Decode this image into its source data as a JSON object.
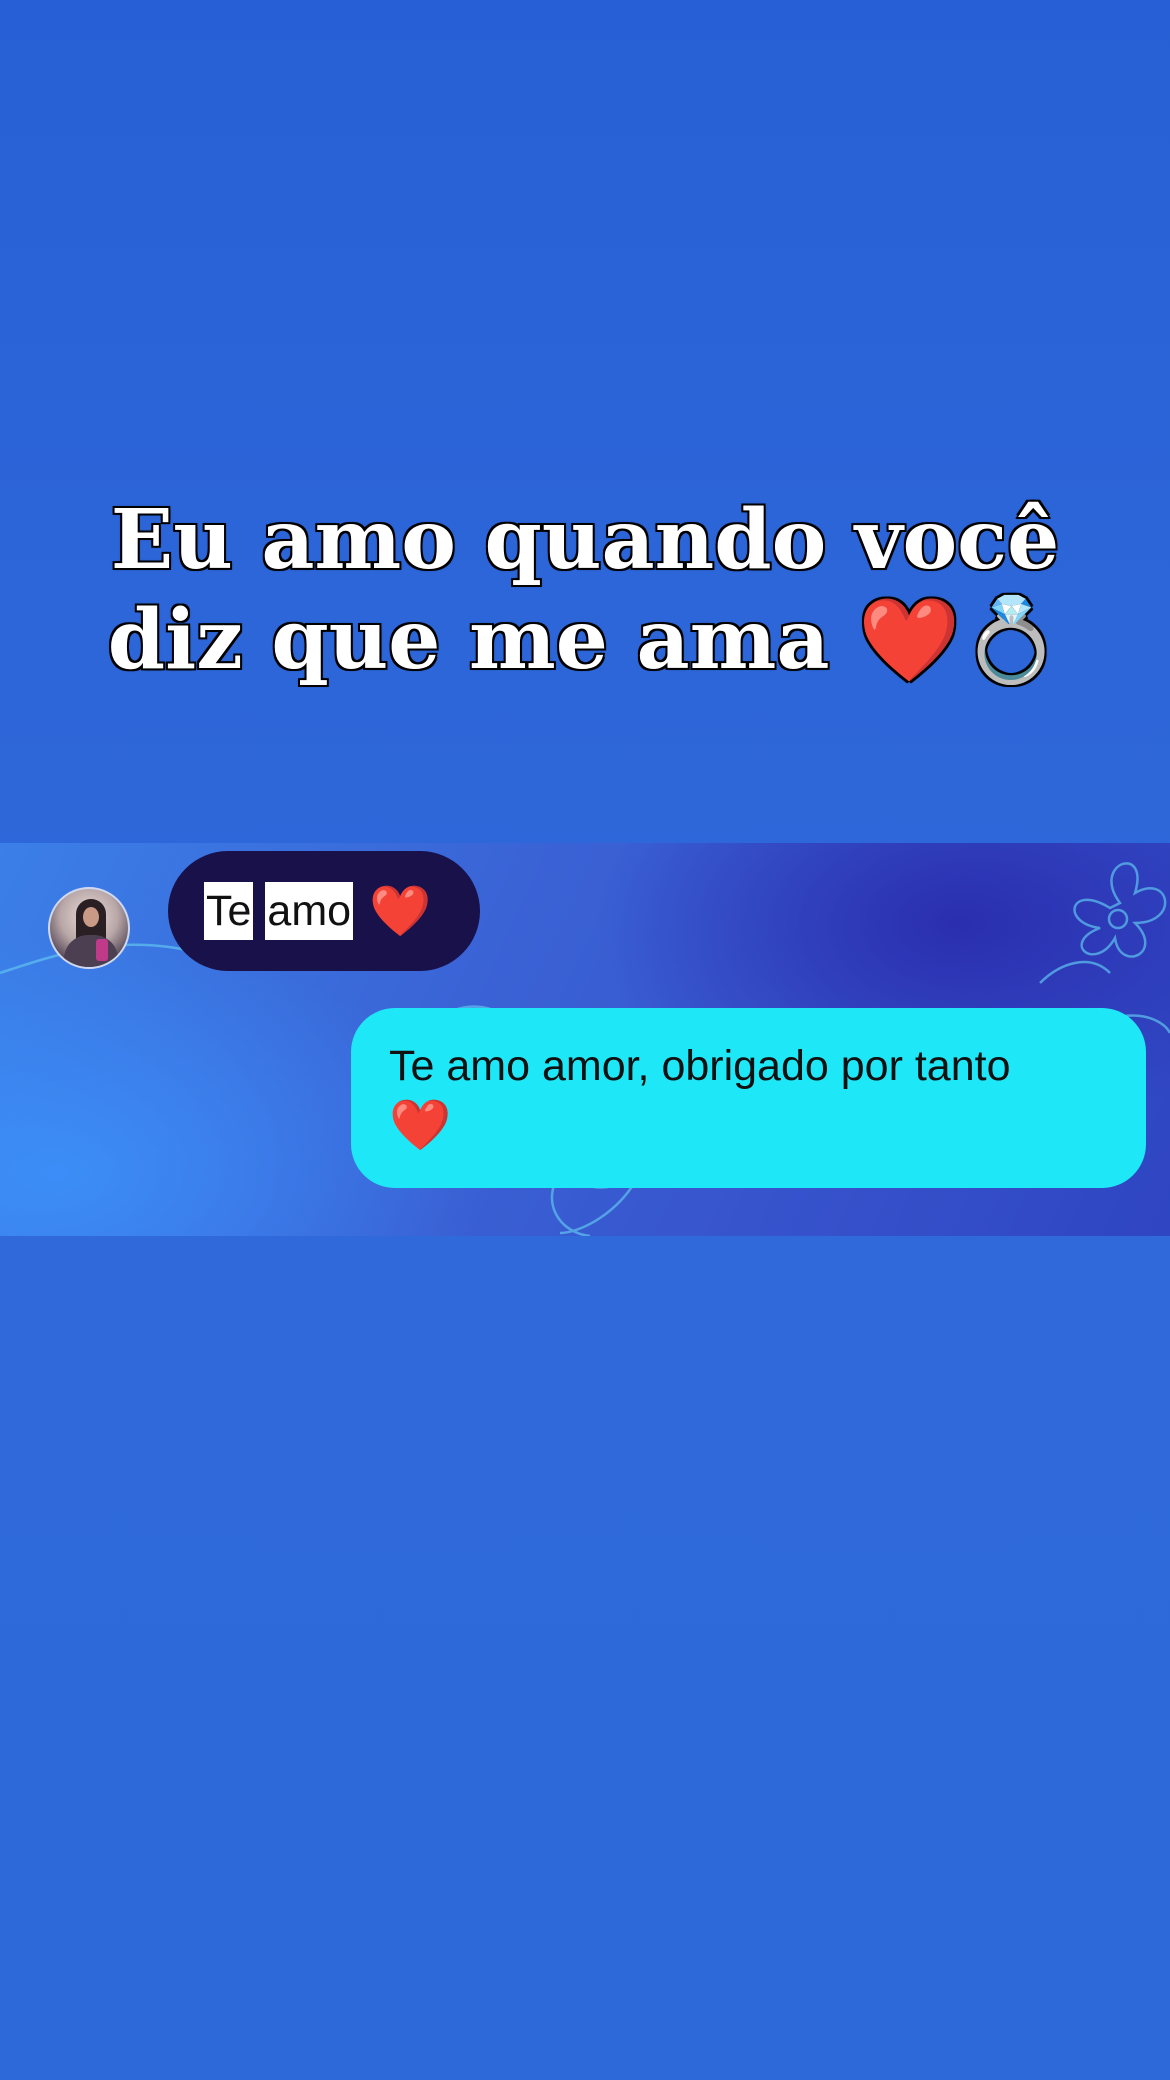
{
  "caption": {
    "line1": "Eu amo quando você",
    "line2": "diz que me ama ❤️💍"
  },
  "chat": {
    "incoming": {
      "word1": "Te",
      "word2": "amo",
      "emoji": "❤️",
      "avatar_icon": "profile-photo"
    },
    "outgoing": {
      "text": "Te amo amor, obrigado por tanto",
      "emoji": "❤️"
    }
  },
  "colors": {
    "background": "#2d66d8",
    "incoming_bubble": "#18114a",
    "outgoing_bubble": "#1ee8f8",
    "highlight": "#ffffff",
    "heart": "#e0102a"
  }
}
